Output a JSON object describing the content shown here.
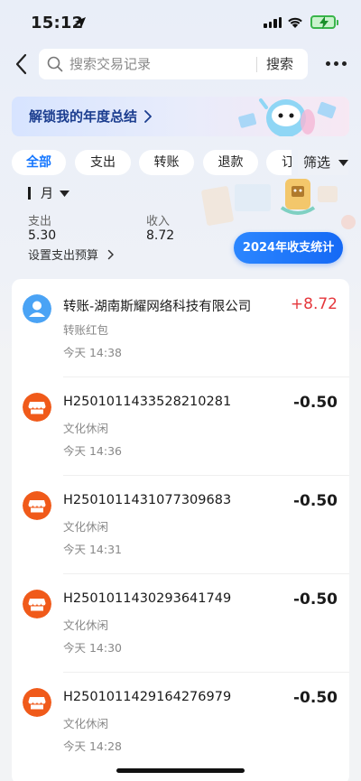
{
  "status_bar": {
    "time": "15:12"
  },
  "header": {
    "search_placeholder": "搜索交易记录",
    "search_button": "搜索"
  },
  "banner": {
    "text": "解锁我的年度总结"
  },
  "filters": {
    "chips": [
      "全部",
      "支出",
      "转账",
      "退款",
      "订单"
    ],
    "active_index": 0,
    "filter_label": "筛选"
  },
  "summary": {
    "month_label": "月",
    "expense_label": "支出",
    "expense_value": "5.30",
    "income_label": "收入",
    "income_value": "8.72",
    "budget_link": "设置支出预算",
    "annual_stats_button": "2024年收支统计"
  },
  "transactions": [
    {
      "title": "转账-湖南斯耀网络科技有限公司",
      "category": "转账红包",
      "time": "今天 14:38",
      "amount": "+8.72",
      "icon": "user-icon",
      "icon_color": "#4aa3f5"
    },
    {
      "title": "H2501011433528210281",
      "category": "文化休闲",
      "time": "今天 14:36",
      "amount": "-0.50",
      "icon": "shop-icon",
      "icon_color": "#f05a1a"
    },
    {
      "title": "H2501011431077309683",
      "category": "文化休闲",
      "time": "今天 14:31",
      "amount": "-0.50",
      "icon": "shop-icon",
      "icon_color": "#f05a1a"
    },
    {
      "title": "H2501011430293641749",
      "category": "文化休闲",
      "time": "今天 14:30",
      "amount": "-0.50",
      "icon": "shop-icon",
      "icon_color": "#f05a1a"
    },
    {
      "title": "H2501011429164276979",
      "category": "文化休闲",
      "time": "今天 14:28",
      "amount": "-0.50",
      "icon": "shop-icon",
      "icon_color": "#f05a1a"
    }
  ],
  "colors": {
    "accent": "#1677ff",
    "income": "#e5373c"
  }
}
